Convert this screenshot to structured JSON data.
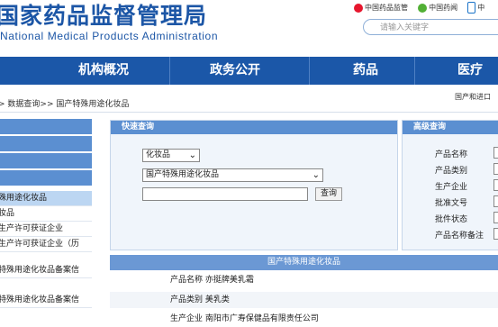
{
  "header": {
    "title_cn": "国家药品监督管理局",
    "title_en": "National Medical Products Administration",
    "links": [
      "中国药品监管",
      "中国药闻",
      "中"
    ],
    "search_placeholder": "请输入关键字"
  },
  "nav": {
    "items": [
      "机构概况",
      "政务公开",
      "药品",
      "医疗"
    ]
  },
  "breadcrumb": "> 数据查询>> 国产特殊用途化妆品",
  "right_note": "国产和进口",
  "sidebar": {
    "items": [
      "殊用途化妆品",
      "妆品",
      "生产许可获证企业",
      "生产许可获证企业（历",
      "特殊用途化妆品备案信",
      "特殊用途化妆品备案信"
    ]
  },
  "quick_search": {
    "title": "快速查询",
    "category_value": "化妆品",
    "subcategory_value": "国产特殊用途化妆品",
    "query_value": "",
    "search_button": "查询"
  },
  "advanced_search": {
    "title": "高级查询",
    "labels": [
      "产品名称",
      "产品类别",
      "生产企业",
      "批准文号",
      "批件状态",
      "产品名称备注"
    ]
  },
  "results": {
    "title": "国产特殊用途化妆品",
    "rows": [
      "产品名称 亦挺牌美乳霜",
      "产品类别 美乳类",
      "生产企业 南阳市广寿保健品有限责任公司"
    ]
  },
  "colors": {
    "brand_blue": "#1b57a8",
    "panel_blue": "#5b8fd1",
    "active_item": "#bcd6f2"
  }
}
